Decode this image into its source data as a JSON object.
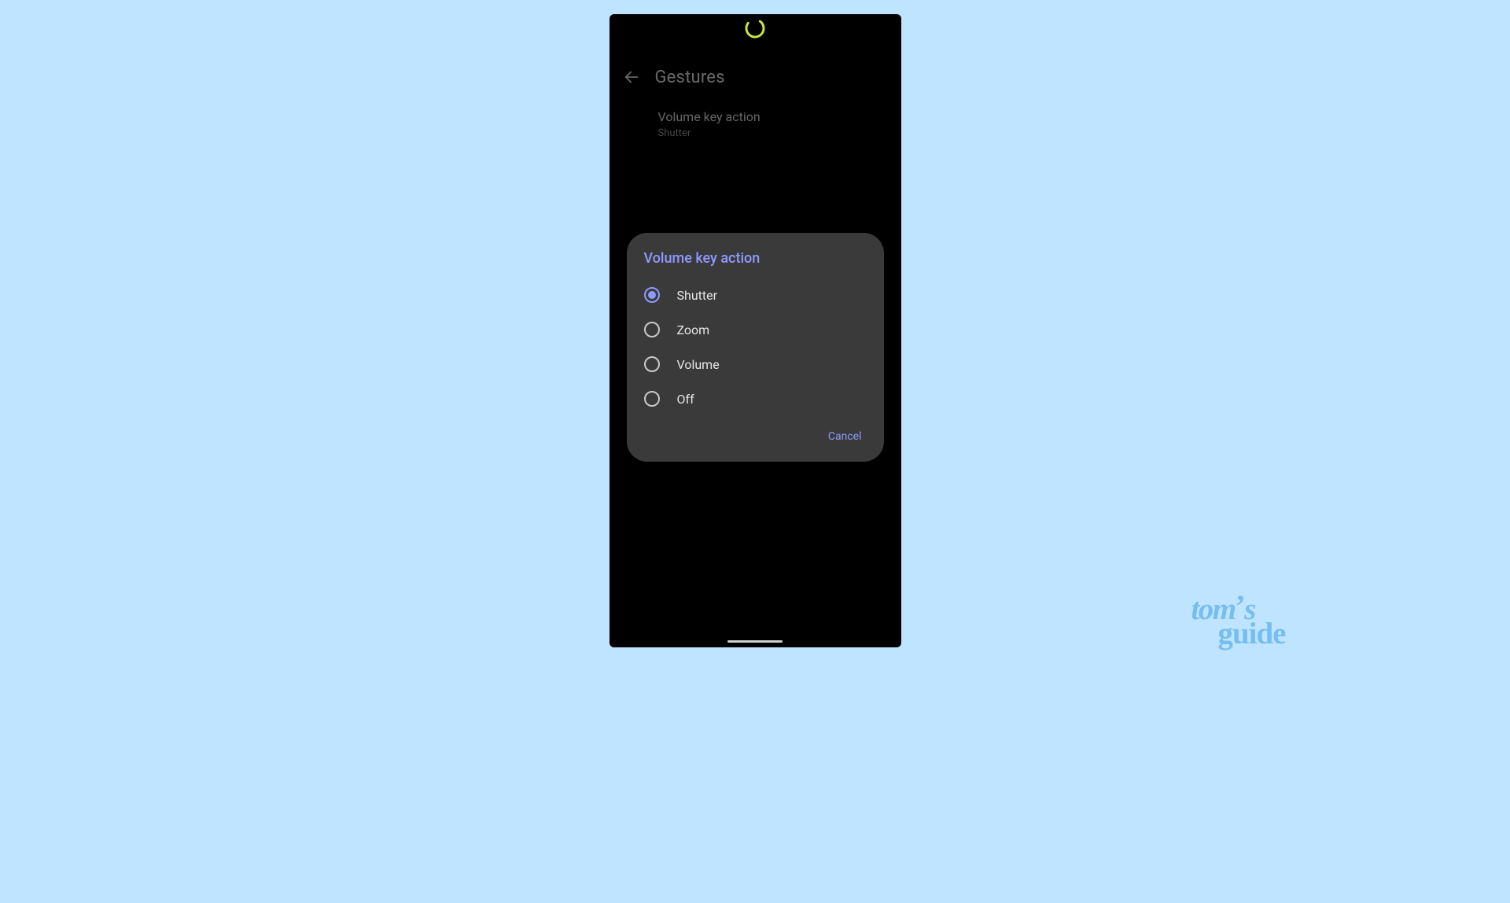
{
  "header": {
    "title": "Gestures"
  },
  "setting": {
    "title": "Volume key action",
    "subtitle": "Shutter"
  },
  "dialog": {
    "title": "Volume key action",
    "options": [
      {
        "label": "Shutter",
        "selected": true
      },
      {
        "label": "Zoom",
        "selected": false
      },
      {
        "label": "Volume",
        "selected": false
      },
      {
        "label": "Off",
        "selected": false
      }
    ],
    "cancel": "Cancel"
  },
  "watermark": {
    "line1_a": "tom",
    "line1_b": "s",
    "line2": "guide"
  },
  "colors": {
    "page_bg": "#bfe4ff",
    "phone_bg": "#000000",
    "dialog_bg": "#3a3a3a",
    "accent": "#8f99ff",
    "spinner": "#c6e63d"
  }
}
